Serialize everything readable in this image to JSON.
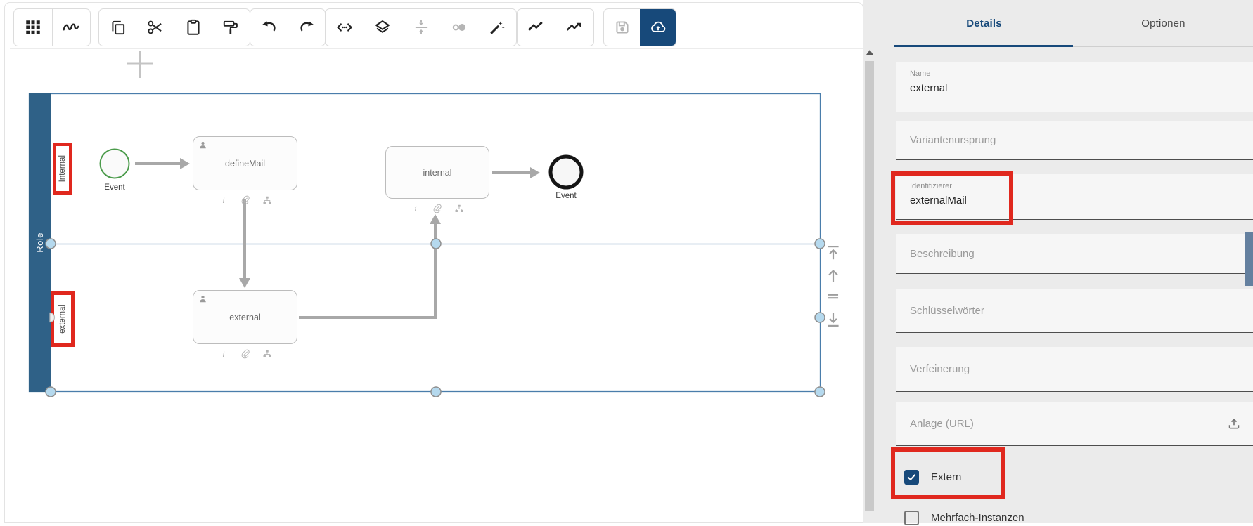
{
  "toolbar": {
    "groups": [
      {
        "buttons": [
          {
            "icon": "grid-menu"
          },
          {
            "icon": "scribble-gesture"
          }
        ]
      },
      {
        "buttons": [
          {
            "icon": "copy"
          },
          {
            "icon": "cut-scissors"
          },
          {
            "icon": "paste-clipboard"
          },
          {
            "icon": "format-paint-roller"
          }
        ]
      },
      {
        "buttons": [
          {
            "icon": "undo"
          },
          {
            "icon": "redo"
          }
        ]
      },
      {
        "buttons": [
          {
            "icon": "code-expand"
          },
          {
            "icon": "layers"
          },
          {
            "icon": "vertical-align-center",
            "disabled": true
          },
          {
            "icon": "toggle-circles",
            "disabled": true
          },
          {
            "icon": "magic-wand"
          }
        ]
      },
      {
        "buttons": [
          {
            "icon": "polyline"
          },
          {
            "icon": "trending-up"
          }
        ]
      },
      {
        "buttons": [
          {
            "icon": "save-disk",
            "disabled": true
          },
          {
            "icon": "cloud-upload",
            "active": true
          }
        ]
      }
    ]
  },
  "canvas": {
    "pool": {
      "role": "Role",
      "lanes": [
        {
          "label": "Internal",
          "highlighted": true
        },
        {
          "label": "external",
          "highlighted": true
        }
      ]
    },
    "nodes": {
      "start_event": {
        "label": "Event",
        "type": "start-event"
      },
      "task_definemail": {
        "label": "defineMail"
      },
      "task_internal": {
        "label": "internal"
      },
      "task_external": {
        "label": "external"
      },
      "end_event": {
        "label": "Event",
        "type": "end-event"
      }
    },
    "lane_controls": [
      {
        "icon": "move-to-top"
      },
      {
        "icon": "move-up"
      },
      {
        "icon": "equals"
      },
      {
        "icon": "move-to-bottom"
      }
    ]
  },
  "panel": {
    "tabs": [
      {
        "label": "Details",
        "active": true
      },
      {
        "label": "Optionen",
        "active": false
      }
    ],
    "fields": [
      {
        "label": "Name",
        "value": "external"
      },
      {
        "label": "Variantenursprung",
        "value": ""
      },
      {
        "label": "Identifizierer",
        "value": "externalMail",
        "highlighted": true
      },
      {
        "label": "Beschreibung",
        "value": ""
      },
      {
        "label": "Schlüsselwörter",
        "value": ""
      },
      {
        "label": "Verfeinerung",
        "value": ""
      },
      {
        "label": "Anlage (URL)",
        "value": "",
        "trailing_icon": "upload"
      }
    ],
    "checkboxes": [
      {
        "label": "Extern",
        "checked": true,
        "highlighted": true
      },
      {
        "label": "Mehrfach-Instanzen",
        "checked": false
      }
    ]
  },
  "colors": {
    "accent_blue": "#17497a",
    "role_bar_blue": "#2f6187",
    "highlight_red": "#e0281e",
    "selection_blue": "#4a7dab",
    "start_event_green": "#4b9b4b",
    "panel_bg": "#ebebeb",
    "scroll_thumb_blue": "#64809f",
    "arrow_grey": "#a8a8a8"
  }
}
